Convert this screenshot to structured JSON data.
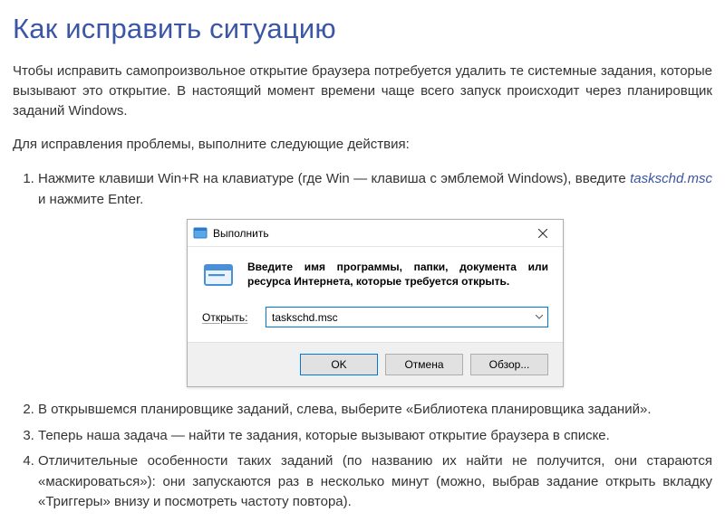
{
  "heading": "Как исправить ситуацию",
  "intro": "Чтобы исправить самопроизвольное открытие браузера потребуется удалить те системные задания, которые вызывают это открытие. В настоящий момент времени чаще всего запуск происходит через планировщик заданий Windows.",
  "lead": "Для исправления проблемы, выполните следующие действия:",
  "steps": {
    "s1_a": "Нажмите клавиши Win+R на клавиатуре (где Win — клавиша с эмблемой Windows), введите ",
    "s1_cmd": "taskschd.msc",
    "s1_b": " и нажмите Enter.",
    "s2": "В открывшемся планировщике заданий, слева, выберите «Библиотека планировщика заданий».",
    "s3": "Теперь наша задача — найти те задания, которые вызывают открытие браузера в списке.",
    "s4": "Отличительные особенности таких заданий (по названию их найти не получится, они стараются «маскироваться»): они запускаются раз в несколько минут (можно, выбрав задание открыть вкладку «Триггеры» внизу и посмотреть частоту повтора)."
  },
  "run_dialog": {
    "title": "Выполнить",
    "description": "Введите имя программы, папки, документа или ресурса Интернета, которые требуется открыть.",
    "open_label": "Открыть:",
    "input_value": "taskschd.msc",
    "ok": "OK",
    "cancel": "Отмена",
    "browse": "Обзор..."
  }
}
